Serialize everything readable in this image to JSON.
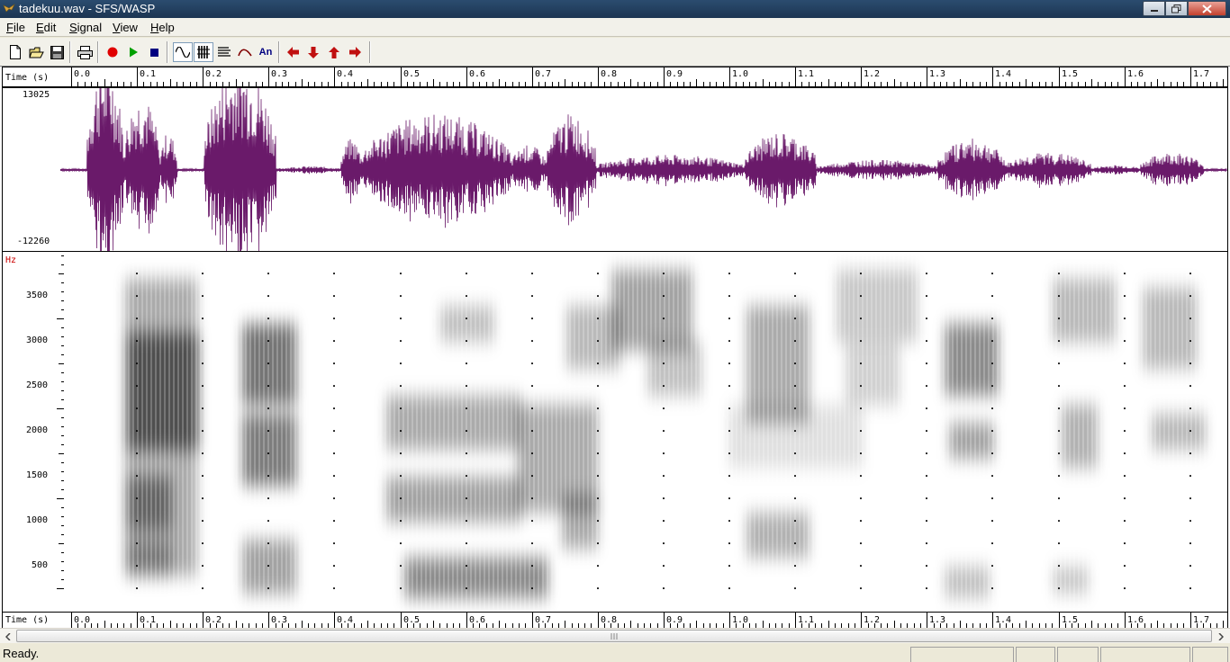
{
  "window": {
    "title": "tadekuu.wav - SFS/WASP"
  },
  "menu": [
    "File",
    "Edit",
    "Signal",
    "View",
    "Help"
  ],
  "toolbar": {
    "buttons": [
      {
        "name": "new-file-icon",
        "interactable": true
      },
      {
        "name": "open-folder-icon",
        "interactable": true
      },
      {
        "name": "save-disk-icon",
        "interactable": true
      },
      {
        "name": "print-icon",
        "interactable": true
      },
      {
        "name": "record-icon",
        "interactable": true
      },
      {
        "name": "play-icon",
        "interactable": true
      },
      {
        "name": "stop-icon",
        "interactable": true
      },
      {
        "name": "waveform-view-icon",
        "interactable": true
      },
      {
        "name": "wideband-spectrogram-icon",
        "interactable": true
      },
      {
        "name": "narrowband-spectrogram-icon",
        "interactable": true
      },
      {
        "name": "pitch-track-icon",
        "interactable": true
      },
      {
        "name": "annotation-icon",
        "interactable": true
      },
      {
        "name": "arrow-left-icon",
        "interactable": true
      },
      {
        "name": "arrow-down-icon",
        "interactable": true
      },
      {
        "name": "arrow-up-icon",
        "interactable": true
      },
      {
        "name": "arrow-right-icon",
        "interactable": true
      }
    ],
    "annotation_label": "An"
  },
  "time_axis": {
    "label": "Time (s)",
    "ticks": [
      "0.0",
      "0.1",
      "0.2",
      "0.3",
      "0.4",
      "0.5",
      "0.6",
      "0.7",
      "0.8",
      "0.9",
      "1.0",
      "1.1",
      "1.2",
      "1.3",
      "1.4",
      "1.5",
      "1.6",
      "1.7"
    ]
  },
  "waveform": {
    "max_label": "13025",
    "min_label": "-12260",
    "color": "#6a1a6a"
  },
  "spectrogram": {
    "unit_label": "Hz",
    "freq_ticks": [
      "3500",
      "3000",
      "2500",
      "2000",
      "1500",
      "1000",
      "500"
    ]
  },
  "status": {
    "text": "Ready."
  },
  "colors": {
    "axis_unit": "#cc0000",
    "record": "#e00000",
    "play": "#00a000",
    "stop": "#000080",
    "arrow": "#c01010"
  }
}
